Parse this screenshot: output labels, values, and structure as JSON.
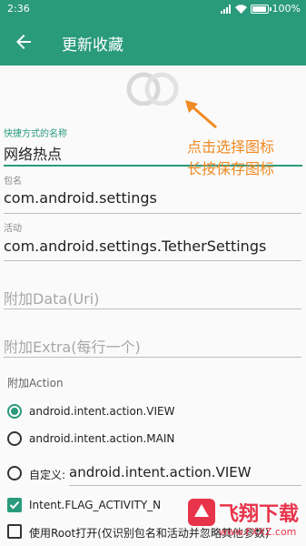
{
  "status": {
    "time": "2:36",
    "battery": "100%",
    "battery_level": 1.0
  },
  "toolbar": {
    "title": "更新收藏"
  },
  "form": {
    "name_label": "快捷方式的名称",
    "name_value": "网络热点",
    "package_label": "包名",
    "package_value": "com.android.settings",
    "activity_label": "活动",
    "activity_value": "com.android.settings.TetherSettings",
    "data_placeholder": "附加Data(Uri)",
    "extra_placeholder": "附加Extra(每行一个)",
    "action_label": "附加Action",
    "actions": [
      {
        "label": "android.intent.action.VIEW",
        "checked": true
      },
      {
        "label": "android.intent.action.MAIN",
        "checked": false
      }
    ],
    "custom_label": "自定义:",
    "custom_value": "android.intent.action.VIEW",
    "flag_label": "Intent.FLAG_ACTIVITY_N",
    "root_label": "使用Root打开(仅识别包名和活动并忽略其他参数)"
  },
  "annotation": {
    "line1": "点击选择图标",
    "line2": "长按保存图标"
  },
  "watermark": {
    "text": "飞翔下载",
    "url": "www.FXXZ.com"
  },
  "colors": {
    "primary": "#2a9a7c",
    "annotation": "#f08a24",
    "watermark": "#e8344a"
  }
}
